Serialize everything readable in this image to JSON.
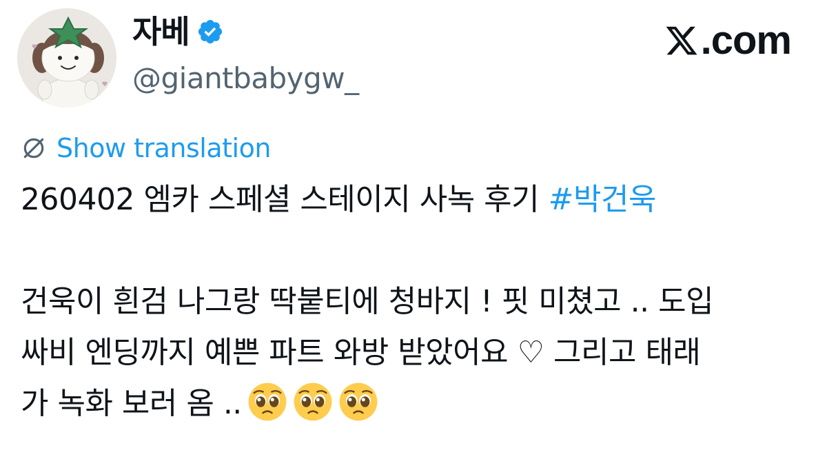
{
  "author": {
    "display_name": "자베",
    "handle": "@giantbabygw_",
    "verified": true,
    "avatar_icon": "plush-doll-avatar"
  },
  "brand": {
    "site": ".com",
    "logo_icon": "x-logo-icon"
  },
  "translate": {
    "label": "Show translation",
    "icon": "globe-icon",
    "color": "#1d9bf0"
  },
  "tweet": {
    "line1_text": "260402 엠카 스페셜 스테이지 사녹 후기 ",
    "hashtag": "#박건욱",
    "line2": "건욱이 흰검 나그랑 딱붙티에 청바지 ! 핏 미쳤고 .. 도입",
    "line3": "싸비 엔딩까지 예쁜 파트 와방 받았어요 ♡ 그리고 태래",
    "line4_text": "가 녹화 보러 옴 ..",
    "emoji_icon": "pleading-face-emoji",
    "emoji_count": 3
  },
  "colors": {
    "text": "#0f1419",
    "secondary": "#536471",
    "link": "#1d9bf0"
  }
}
